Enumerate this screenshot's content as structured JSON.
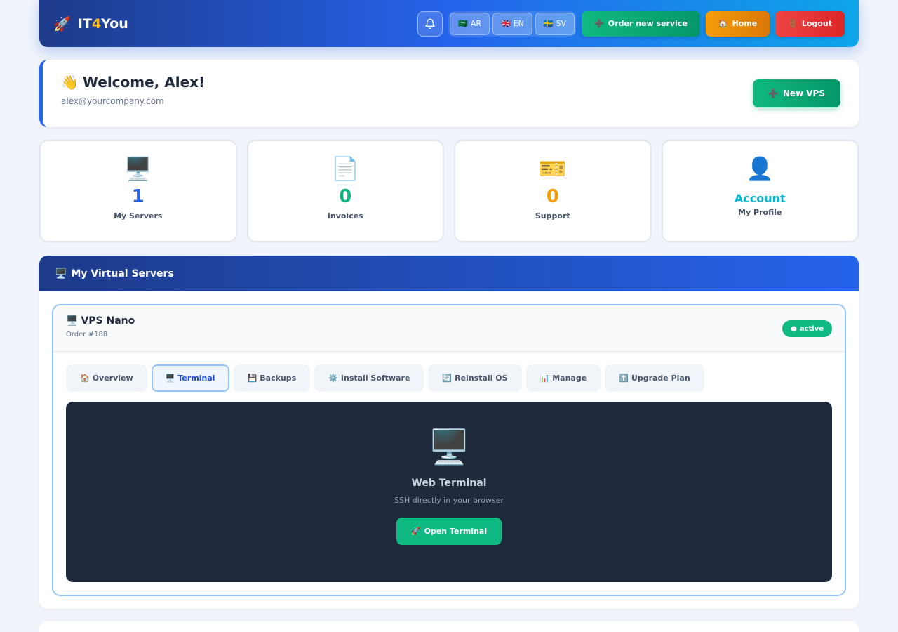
{
  "brand": {
    "icon": "🚀",
    "part1": "IT",
    "part2": "4",
    "part3": "You"
  },
  "header": {
    "languages": [
      {
        "flag": "🇸🇦",
        "code": "AR"
      },
      {
        "flag": "🇬🇧",
        "code": "EN"
      },
      {
        "flag": "🇸🇪",
        "code": "SV"
      }
    ],
    "order_label": "Order new service",
    "order_icon": "➕",
    "home_label": "Home",
    "home_icon": "🏠",
    "logout_label": "Logout",
    "logout_icon": "🚪"
  },
  "welcome": {
    "wave": "👋",
    "title": "Welcome, Alex!",
    "email": "alex@yourcompany.com",
    "new_vps_icon": "➕",
    "new_vps_label": "New VPS"
  },
  "stats": {
    "servers": {
      "icon": "🖥️",
      "value": "1",
      "label": "My Servers",
      "color": "#2563eb"
    },
    "invoices": {
      "icon": "📄",
      "value": "0",
      "label": "Invoices",
      "color": "#10b981"
    },
    "support": {
      "icon": "🎫",
      "value": "0",
      "label": "Support",
      "color": "#f59e0b"
    },
    "account": {
      "icon": "👤",
      "title": "Account",
      "label": "My Profile"
    }
  },
  "servers": {
    "icon": "🖥️",
    "title": "My Virtual Servers",
    "vps": {
      "icon": "🖥️",
      "name": "VPS Nano",
      "order": "Order #188",
      "status": "active",
      "status_dot": "●"
    },
    "tabs": [
      {
        "icon": "🏠",
        "label": "Overview"
      },
      {
        "icon": "🖥️",
        "label": "Terminal"
      },
      {
        "icon": "💾",
        "label": "Backups"
      },
      {
        "icon": "⚙️",
        "label": "Install Software"
      },
      {
        "icon": "🔄",
        "label": "Reinstall OS"
      },
      {
        "icon": "📊",
        "label": "Manage"
      },
      {
        "icon": "⬆️",
        "label": "Upgrade Plan"
      }
    ],
    "terminal": {
      "icon": "🖥️",
      "title": "Web Terminal",
      "subtitle": "SSH directly in your browser",
      "button_icon": "🚀",
      "button_label": "Open Terminal"
    }
  }
}
